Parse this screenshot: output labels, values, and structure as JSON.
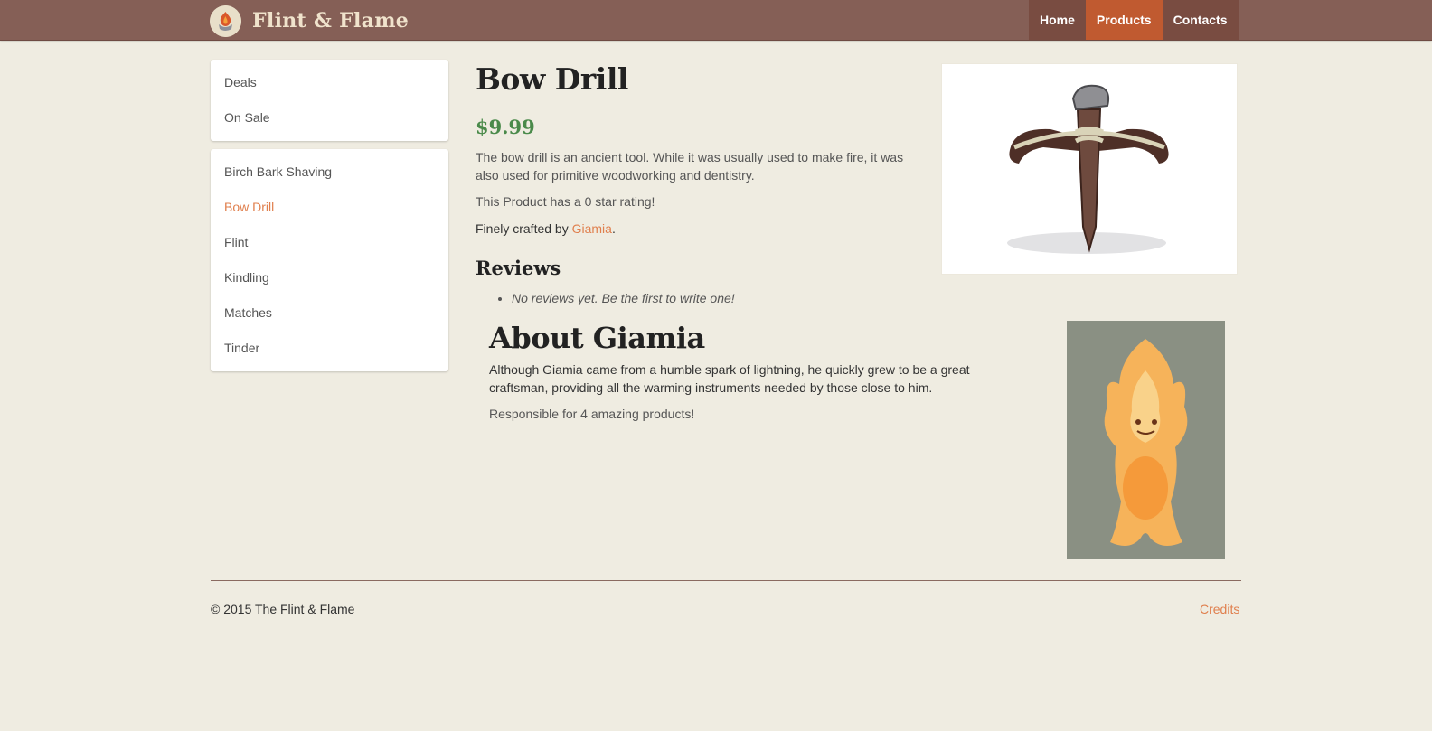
{
  "header": {
    "brand": "Flint & Flame",
    "nav": [
      {
        "label": "Home",
        "active": false
      },
      {
        "label": "Products",
        "active": true
      },
      {
        "label": "Contacts",
        "active": false
      }
    ]
  },
  "sidebar": {
    "top_items": [
      {
        "label": "Deals"
      },
      {
        "label": "On Sale"
      }
    ],
    "product_items": [
      {
        "label": "Birch Bark Shaving",
        "active": false
      },
      {
        "label": "Bow Drill",
        "active": true
      },
      {
        "label": "Flint",
        "active": false
      },
      {
        "label": "Kindling",
        "active": false
      },
      {
        "label": "Matches",
        "active": false
      },
      {
        "label": "Tinder",
        "active": false
      }
    ]
  },
  "product": {
    "title": "Bow Drill",
    "price": "$9.99",
    "description": "The bow drill is an ancient tool. While it was usually used to make fire, it was also used for primitive woodworking and dentistry.",
    "rating_text": "This Product has a 0 star rating!",
    "crafted_prefix": "Finely crafted by ",
    "crafter": "Giamia",
    "crafted_suffix": ".",
    "image_icon": "bow-drill-illustration"
  },
  "reviews": {
    "heading": "Reviews",
    "empty_message": "No reviews yet. Be the first to write one!"
  },
  "about": {
    "heading": "About Giamia",
    "text": "Although Giamia came from a humble spark of lightning, he quickly grew to be a great craftsman, providing all the warming instruments needed by those close to him.",
    "count_text": "Responsible for 4 amazing products!",
    "image_icon": "flame-creature-illustration"
  },
  "footer": {
    "copyright": "© 2015 The Flint & Flame",
    "credits": "Credits"
  },
  "colors": {
    "header_bg": "#855f56",
    "nav_active": "#c05a30",
    "accent": "#e07f4d",
    "price": "#4a8a4a",
    "page_bg": "#efece1"
  }
}
